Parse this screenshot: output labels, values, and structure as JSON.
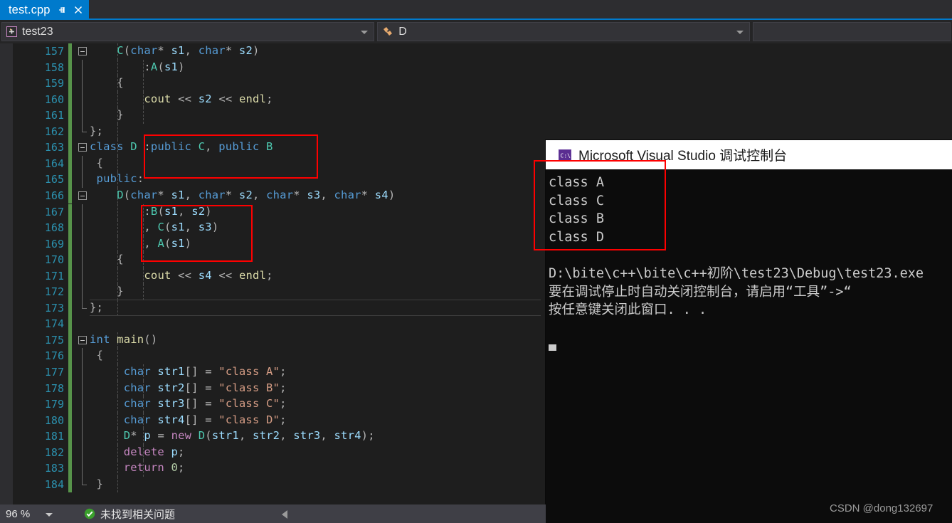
{
  "tab": {
    "title": "test.cpp",
    "pin_icon": "pin-icon",
    "close_icon": "close-icon"
  },
  "navbar": {
    "project": "test23",
    "project_icon": "class-member-icon",
    "member": "D",
    "member_icon": "member-puzzle-icon",
    "dropdown_icon": "chevron-down-icon"
  },
  "editor": {
    "first_line": 157,
    "lines": [
      {
        "n": 157,
        "text": "    C(char* s1, char* s2)"
      },
      {
        "n": 158,
        "text": "        :A(s1)"
      },
      {
        "n": 159,
        "text": "    {"
      },
      {
        "n": 160,
        "text": "        cout << s2 << endl;"
      },
      {
        "n": 161,
        "text": "    }"
      },
      {
        "n": 162,
        "text": "};"
      },
      {
        "n": 163,
        "text": "class D :public C, public B"
      },
      {
        "n": 164,
        "text": " {"
      },
      {
        "n": 165,
        "text": " public:"
      },
      {
        "n": 166,
        "text": "    D(char* s1, char* s2, char* s3, char* s4)"
      },
      {
        "n": 167,
        "text": "        :B(s1, s2)"
      },
      {
        "n": 168,
        "text": "        , C(s1, s3)"
      },
      {
        "n": 169,
        "text": "        , A(s1)"
      },
      {
        "n": 170,
        "text": "    {"
      },
      {
        "n": 171,
        "text": "        cout << s4 << endl;"
      },
      {
        "n": 172,
        "text": "    }"
      },
      {
        "n": 173,
        "text": "};"
      },
      {
        "n": 174,
        "text": ""
      },
      {
        "n": 175,
        "text": "int main()"
      },
      {
        "n": 176,
        "text": " {"
      },
      {
        "n": 177,
        "text": "     char str1[] = \"class A\";"
      },
      {
        "n": 178,
        "text": "     char str2[] = \"class B\";"
      },
      {
        "n": 179,
        "text": "     char str3[] = \"class C\";"
      },
      {
        "n": 180,
        "text": "     char str4[] = \"class D\";"
      },
      {
        "n": 181,
        "text": "     D* p = new D(str1, str2, str3, str4);"
      },
      {
        "n": 182,
        "text": "     delete p;"
      },
      {
        "n": 183,
        "text": "     return 0;"
      },
      {
        "n": 184,
        "text": " }"
      }
    ],
    "annotations": [
      {
        "name": "inheritance-list-highlight",
        "color": "#fe0000"
      },
      {
        "name": "init-list-highlight",
        "color": "#fe0000"
      }
    ]
  },
  "console": {
    "title": "Microsoft Visual Studio 调试控制台",
    "icon": "cmd-console-icon",
    "output_lines": [
      "class A",
      "class C",
      "class B",
      "class D"
    ],
    "info_lines": [
      "D:\\bite\\c++\\bite\\c++初阶\\test23\\Debug\\test23.exe",
      "要在调试停止时自动关闭控制台，请启用“工具”->“",
      "按任意键关闭此窗口. . ."
    ],
    "annotation_color": "#fe0000"
  },
  "statusbar": {
    "zoom": "96 %",
    "status_icon": "check-circle-icon",
    "status_message": "未找到相关问题",
    "scroll_left_icon": "caret-left-icon"
  },
  "watermark": "CSDN @dong132697",
  "colors": {
    "accent": "#007acc",
    "annotation_red": "#fe0000",
    "editor_bg": "#1e1e1e",
    "console_bg": "#0c0c0c",
    "change_bar": "#57934a"
  }
}
